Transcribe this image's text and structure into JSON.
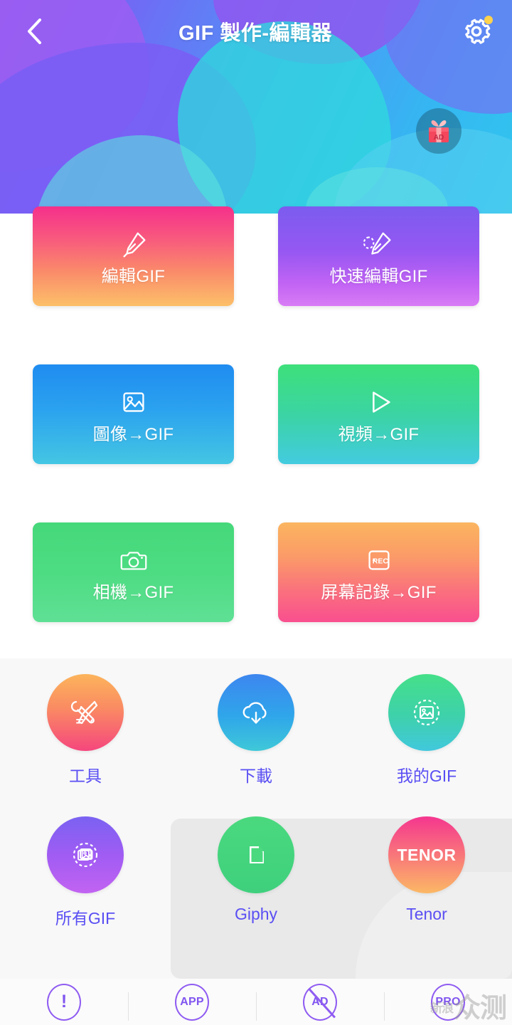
{
  "header": {
    "title": "GIF 製作-編輯器",
    "back_icon": "chevron-left-icon",
    "settings_icon": "gear-icon",
    "settings_badge": true,
    "ad_gift_icon": "gift-box-ad-icon",
    "ad_gift_label": "AD",
    "gradient_from": "#8d57f0",
    "gradient_to": "#31c6ee"
  },
  "cards": [
    {
      "label": "編輯GIF",
      "icon": "brush-icon",
      "gradient": "#f5308b → #fcc069"
    },
    {
      "label": "快速編輯GIF",
      "icon": "brush-dashed-icon",
      "gradient": "#7b5cf0 → #d97cf5"
    },
    {
      "label": "圖像→GIF",
      "icon": "image-icon",
      "gradient": "#1f8cf0 → #44c6e3"
    },
    {
      "label": "視頻→GIF",
      "icon": "play-icon",
      "gradient": "#3de07a → #43cbe0"
    },
    {
      "label": "相機→GIF",
      "icon": "camera-icon",
      "gradient": "#45d87a → #5fe095"
    },
    {
      "label": "屏幕記錄→GIF",
      "icon": "rec-box-icon",
      "gradient": "#fbb55f → #f94f8f"
    }
  ],
  "rec_icon_text": "•REC",
  "tools": [
    {
      "label": "工具",
      "icon": "tools-wrench-screwdriver-icon",
      "gradient": "#fcb45b → #f5467d"
    },
    {
      "label": "下載",
      "icon": "cloud-download-icon",
      "gradient": "#3d86ef → #3fc8d8"
    },
    {
      "label": "我的GIF",
      "icon": "my-gif-dashed-image-icon",
      "gradient": "#45e089 → #41c8dd"
    },
    {
      "label": "所有GIF",
      "icon": "all-gif-stacked-images-icon",
      "gradient": "#7a62f2 → #c263f2"
    },
    {
      "label": "Giphy",
      "icon": "giphy-document-icon",
      "gradient": "#4ad97e → #3fd07d"
    },
    {
      "label": "Tenor",
      "icon": "tenor-wordmark-icon",
      "gradient": "#f5368f → #fbb865",
      "inner_text": "TENOR"
    }
  ],
  "label_color": "#5a4ff3",
  "bottom_bar": [
    {
      "name": "info",
      "icon": "exclamation-circle-icon",
      "text": "!"
    },
    {
      "name": "app",
      "icon": "app-circle-icon",
      "text": "APP"
    },
    {
      "name": "no-ads",
      "icon": "no-ad-circle-icon",
      "text": "AD"
    },
    {
      "name": "pro",
      "icon": "pro-circle-icon",
      "text": "PRO"
    }
  ],
  "watermark": {
    "small": "新浪",
    "large": "众测"
  }
}
